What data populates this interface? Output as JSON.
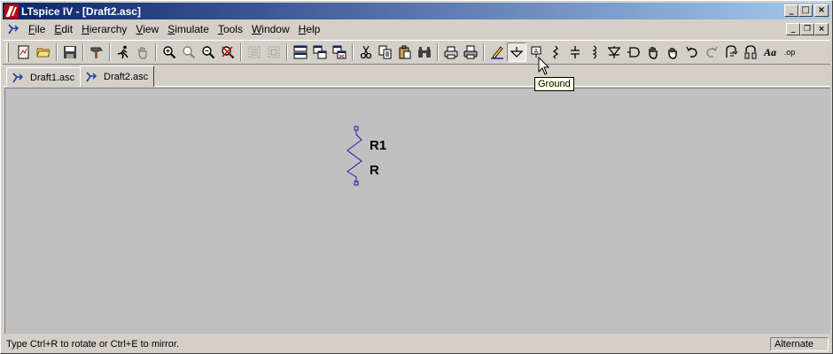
{
  "window": {
    "title": "LTspice IV - [Draft2.asc]",
    "minimize_glyph": "_",
    "maximize_glyph": "□",
    "close_glyph": "×"
  },
  "menu": {
    "items": [
      {
        "label": "File",
        "accel": "F",
        "rest": "ile"
      },
      {
        "label": "Edit",
        "accel": "E",
        "rest": "dit"
      },
      {
        "label": "Hierarchy",
        "accel": "H",
        "rest": "ierarchy"
      },
      {
        "label": "View",
        "accel": "V",
        "rest": "iew"
      },
      {
        "label": "Simulate",
        "accel": "S",
        "rest": "imulate"
      },
      {
        "label": "Tools",
        "accel": "T",
        "rest": "ools"
      },
      {
        "label": "Window",
        "accel": "W",
        "rest": "indow"
      },
      {
        "label": "Help",
        "accel": "H",
        "rest": "elp"
      }
    ],
    "mdi_minimize": "_",
    "mdi_restore": "❐",
    "mdi_close": "×"
  },
  "toolbar": {
    "font_button": "Aa",
    "spice_directive_button": ".op"
  },
  "tabs": [
    {
      "label": "Draft1.asc",
      "active": false
    },
    {
      "label": "Draft2.asc",
      "active": true
    }
  ],
  "schematic": {
    "component_name": "R1",
    "component_value": "R",
    "wire_color": "#1a1aaa"
  },
  "tooltip": {
    "text": "Ground"
  },
  "status": {
    "message": "Type Ctrl+R to rotate or Ctrl+E to mirror.",
    "mode": "Alternate"
  },
  "colors": {
    "title_start": "#0a246a",
    "title_end": "#a6caf0",
    "canvas": "#c0c0c0",
    "chrome": "#d4d0c8"
  }
}
